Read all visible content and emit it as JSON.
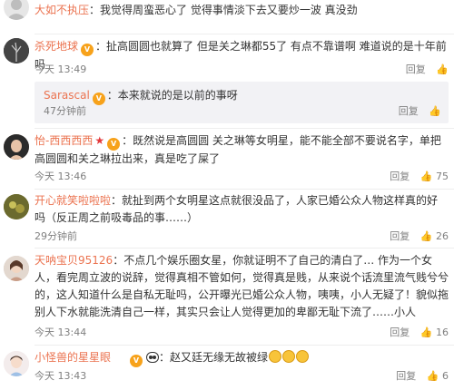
{
  "comments": [
    {
      "user": "大如不执压",
      "text": "：我觉得周蛮恶心了 觉得事情淡下去又要炒一波 真没劲",
      "time": "",
      "reply_label": "",
      "like_count": ""
    },
    {
      "user": "杀死地球",
      "text": "：扯高圆圆也就算了 但是关之琳都55了 有点不靠谱啊 难道说的是十年前吗",
      "time": "今天 13:49",
      "reply_label": "回复",
      "like_count": "",
      "nested_reply": {
        "user": "Sarascal",
        "text": "：本来就说的是以前的事呀",
        "time": "47分钟前",
        "reply_label": "回复",
        "like_count": ""
      }
    },
    {
      "user": "怡-西西西西",
      "text": "：既然说是高圆圆 关之琳等女明星，能不能全部不要说名字，单把高圆圆和关之琳拉出来，真是吃了屎了",
      "time": "今天 13:46",
      "reply_label": "回复",
      "like_count": "75"
    },
    {
      "user": "开心就笑啦啦啦",
      "text": "：就扯到两个女明星这点就很没品了，人家已婚公众人物这样真的好吗（反正周之前吸毒品的事……）",
      "time": "29分钟前",
      "reply_label": "回复",
      "like_count": "26"
    },
    {
      "user": "天呐宝贝95126",
      "text": "：不点几个娱乐圈女星，你就证明不了自己的清白了… 作为一个女人，看完周立波的说辞，觉得真相不管如何，觉得真是贱，从来说个话流里流气贱兮兮的，这人知道什么是自私无耻吗，公开曝光已婚公众人物，咦咦，小人无疑了！貌似拖别人下水就能洗清自己一样，其实只会让人觉得更加的卑鄙无耻下流了……小人",
      "time": "今天 13:44",
      "reply_label": "回复",
      "like_count": "16"
    },
    {
      "user": "小怪兽的星星眼",
      "text": "：赵又廷无缘无故被绿",
      "time": "今天 13:43",
      "reply_label": "回复",
      "like_count": "6"
    }
  ],
  "icons": {
    "like": "thumbs-up-icon",
    "vip_badge": "vip-badge-icon",
    "star": "red-star-icon",
    "panda": "panda-emoji-icon",
    "laugh": "laughing-emoji-icon"
  },
  "colors": {
    "username": "#eb7350",
    "meta": "#808080",
    "reply_bg": "#f2f2f5"
  }
}
